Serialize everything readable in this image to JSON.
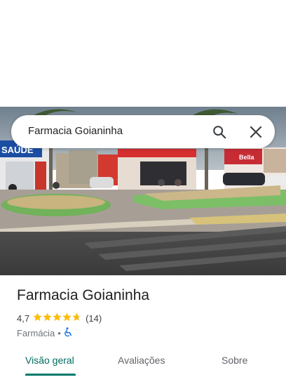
{
  "search": {
    "query": "Farmacia Goianinha"
  },
  "photo_signs": {
    "left_sign": "SAÚDE",
    "right_sign": "Bella"
  },
  "place": {
    "name": "Farmacia Goianinha",
    "rating": "4,7",
    "rating_value": 4.7,
    "review_count": "(14)",
    "category": "Farmácia",
    "separator": "•",
    "accessibility_icon": "wheelchair-icon"
  },
  "tabs": [
    {
      "label": "Visão geral",
      "active": true
    },
    {
      "label": "Avaliações",
      "active": false
    },
    {
      "label": "Sobre",
      "active": false
    }
  ],
  "colors": {
    "accent": "#00796b",
    "star": "#fbbc04",
    "wheelchair": "#1a73e8"
  }
}
